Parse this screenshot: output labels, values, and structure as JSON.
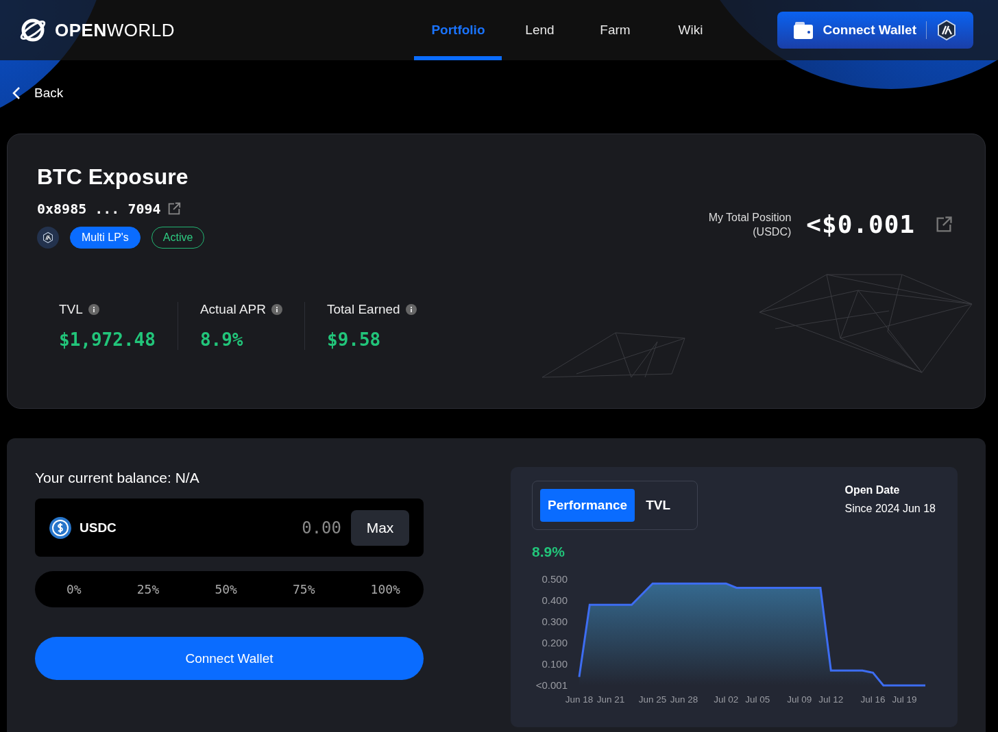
{
  "header": {
    "logo_bold": "OPEN",
    "logo_light": "WORLD",
    "nav": [
      {
        "label": "Portfolio",
        "selected": true
      },
      {
        "label": "Lend",
        "selected": false
      },
      {
        "label": "Farm",
        "selected": false
      },
      {
        "label": "Wiki",
        "selected": false
      }
    ],
    "wallet_button": "Connect Wallet"
  },
  "back": "Back",
  "vault": {
    "title": "BTC Exposure",
    "address": "0x8985 ... 7094",
    "tags": [
      {
        "label": "Multi LP's",
        "kind": "filled"
      },
      {
        "label": "Active",
        "kind": "outline"
      }
    ],
    "position_label": "My Total Position",
    "position_unit": "(USDC)",
    "position_value": "<$0.001",
    "stats": [
      {
        "label": "TVL",
        "value": "$1,972.48"
      },
      {
        "label": "Actual APR",
        "value": "8.9%"
      },
      {
        "label": "Total Earned",
        "value": "$9.58"
      }
    ]
  },
  "deposit": {
    "balance": "Your current balance: N/A",
    "token": "USDC",
    "amount_placeholder": "0.00",
    "max": "Max",
    "percents": [
      "0%",
      "25%",
      "50%",
      "75%",
      "100%"
    ],
    "action": "Connect Wallet"
  },
  "performance": {
    "tabs": [
      {
        "label": "Performance",
        "selected": true
      },
      {
        "label": "TVL",
        "selected": false
      }
    ],
    "open_date_label": "Open Date",
    "open_date": "Since 2024 Jun 18",
    "apr": "8.9%",
    "chart_data": {
      "type": "area",
      "categories": [
        "Jun 18",
        null,
        null,
        "Jun 21",
        null,
        null,
        null,
        "Jun 25",
        null,
        null,
        "Jun 28",
        null,
        null,
        null,
        "Jul 02",
        null,
        null,
        "Jul 05",
        null,
        null,
        null,
        "Jul 09",
        null,
        null,
        "Jul 12",
        null,
        null,
        null,
        "Jul 16",
        null,
        null,
        "Jul 19",
        null,
        null
      ],
      "series": [
        {
          "color": "#3d6df2",
          "values": [
            0.04,
            0.38,
            0.38,
            0.38,
            0.38,
            0.38,
            0.43,
            0.48,
            0.48,
            0.48,
            0.48,
            0.48,
            0.48,
            0.48,
            0.48,
            0.46,
            0.46,
            0.46,
            0.46,
            0.46,
            0.46,
            0.46,
            0.46,
            0.46,
            0.07,
            0.07,
            0.07,
            0.07,
            0.06,
            0,
            0,
            0,
            0,
            0
          ]
        }
      ],
      "ylim": [
        0,
        0.5
      ],
      "yticks": [
        {
          "value": 0,
          "label": "<0.001"
        },
        {
          "value": 0.1,
          "label": "0.100"
        },
        {
          "value": 0.2,
          "label": "0.200"
        },
        {
          "value": 0.3,
          "label": "0.300"
        },
        {
          "value": 0.4,
          "label": "0.400"
        },
        {
          "value": 0.5,
          "label": "0.500"
        }
      ]
    }
  }
}
